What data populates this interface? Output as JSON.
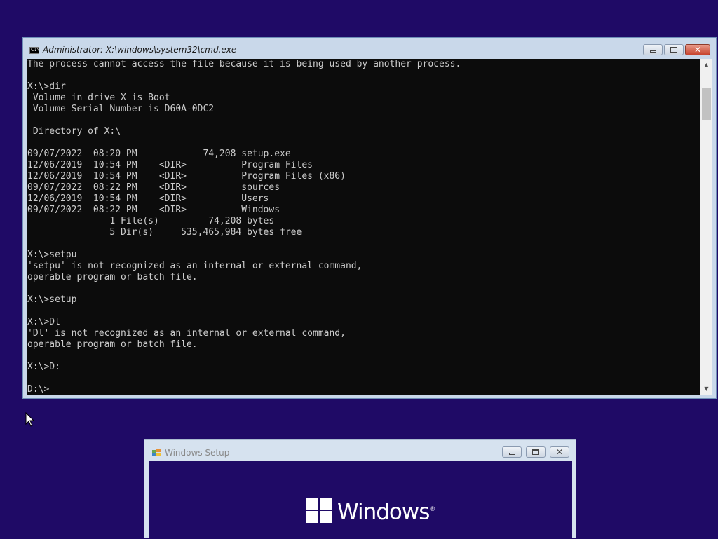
{
  "cmd_window": {
    "title": "Administrator: X:\\windows\\system32\\cmd.exe",
    "icon_text": "C:\\",
    "console_lines": [
      "The process cannot access the file because it is being used by another process.",
      "",
      "X:\\>dir",
      " Volume in drive X is Boot",
      " Volume Serial Number is D60A-0DC2",
      "",
      " Directory of X:\\",
      "",
      "09/07/2022  08:20 PM            74,208 setup.exe",
      "12/06/2019  10:54 PM    <DIR>          Program Files",
      "12/06/2019  10:54 PM    <DIR>          Program Files (x86)",
      "09/07/2022  08:22 PM    <DIR>          sources",
      "12/06/2019  10:54 PM    <DIR>          Users",
      "09/07/2022  08:22 PM    <DIR>          Windows",
      "               1 File(s)         74,208 bytes",
      "               5 Dir(s)     535,465,984 bytes free",
      "",
      "X:\\>setpu",
      "'setpu' is not recognized as an internal or external command,",
      "operable program or batch file.",
      "",
      "X:\\>setup",
      "",
      "X:\\>Dl",
      "'Dl' is not recognized as an internal or external command,",
      "operable program or batch file.",
      "",
      "X:\\>D:",
      "",
      "D:\\>"
    ]
  },
  "setup_window": {
    "title": "Windows Setup",
    "logo_text": "Windows",
    "logo_mark": "®"
  },
  "colors": {
    "desktop_background": "#1f0a66",
    "console_background": "#0c0c0c",
    "console_text": "#cccccc"
  },
  "icons": [
    "cmd-icon",
    "minimize-icon",
    "maximize-icon",
    "close-icon",
    "scroll-up-icon",
    "scroll-down-icon",
    "mouse-pointer-icon",
    "windows-setup-icon",
    "windows-logo-icon"
  ]
}
